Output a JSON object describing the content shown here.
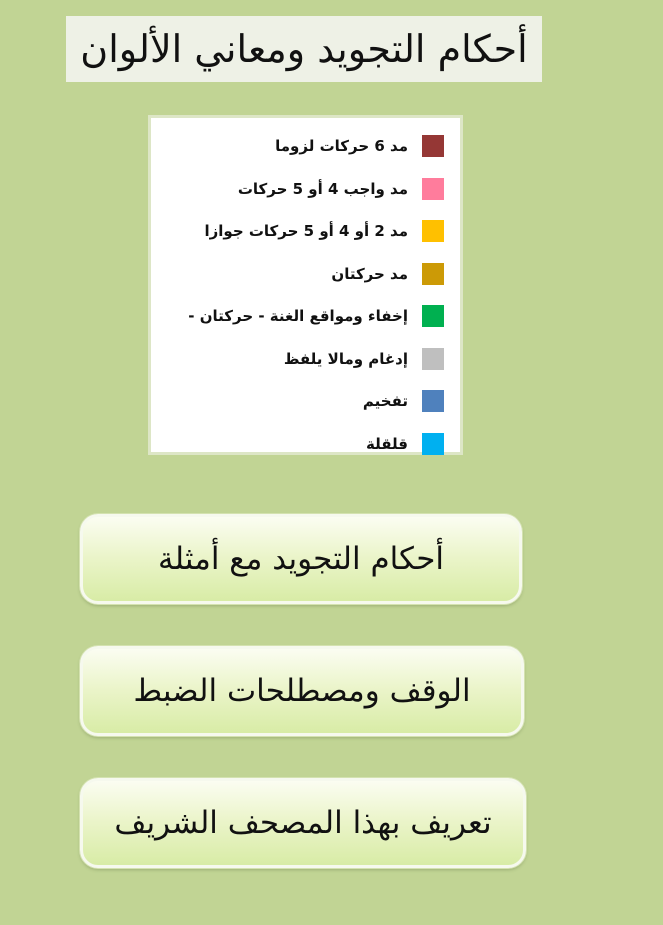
{
  "header": {
    "title": "أحكام التجويد ومعاني الألوان"
  },
  "legend": {
    "items": [
      {
        "label": "مد 6 حركات لزوما",
        "color": "#953735"
      },
      {
        "label": "مد واجب 4 أو 5 حركات",
        "color": "#ff7c9c"
      },
      {
        "label": "مد 2 أو 4 أو 5 حركات جوازا",
        "color": "#ffc000"
      },
      {
        "label": "مد حركتان",
        "color": "#cc9a06"
      },
      {
        "label": "إخفاء ومواقع الغنة - حركتان -",
        "color": "#00b050"
      },
      {
        "label": "إدغام ومالا يلفظ",
        "color": "#bfbfbf"
      },
      {
        "label": "تفخيم",
        "color": "#4f81bd"
      },
      {
        "label": "قلقلة",
        "color": "#00b0f0"
      }
    ]
  },
  "menu": {
    "buttons": [
      {
        "label": "أحكام التجويد مع أمثلة"
      },
      {
        "label": "الوقف ومصطلحات الضبط"
      },
      {
        "label": "تعريف بهذا المصحف الشريف"
      }
    ]
  }
}
